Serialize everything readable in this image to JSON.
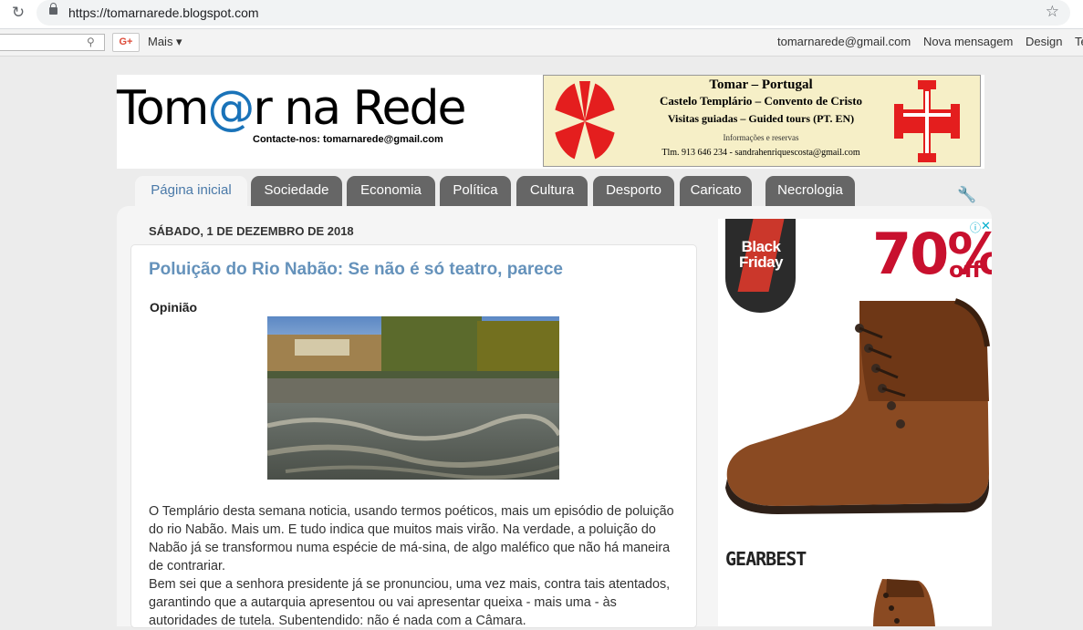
{
  "browser": {
    "url": "https://tomarnarede.blogspot.com"
  },
  "navbar": {
    "gplus_label": "G+",
    "more_label": "Mais ▾",
    "email": "tomarnarede@gmail.com",
    "new_post": "Nova mensagem",
    "design": "Design",
    "cut_off": "Te"
  },
  "header": {
    "title_part1": "Tom",
    "title_at": "@",
    "title_part2": "r na Rede",
    "contact": "Contacte-nos: tomarnarede@gmail.com",
    "banner": {
      "line1": "Tomar – Portugal",
      "line2": "Castelo Templário – Convento de Cristo",
      "line3": "Visitas guiadas – Guided tours (PT. EN)",
      "line4": "Informações e reservas",
      "line5": "Tlm. 913 646 234 - sandrahenriquescosta@gmail.com"
    }
  },
  "tabs": [
    {
      "label": "Página inicial",
      "active": true
    },
    {
      "label": "Sociedade"
    },
    {
      "label": "Economia"
    },
    {
      "label": "Política"
    },
    {
      "label": "Cultura"
    },
    {
      "label": "Desporto"
    },
    {
      "label": "Caricato"
    },
    {
      "label": "Necrologia"
    }
  ],
  "post": {
    "date": "SÁBADO, 1 DE DEZEMBRO DE 2018",
    "title": "Poluição do Rio Nabão: Se não é só teatro, parece",
    "label": "Opinião",
    "body": [
      "O Templário desta semana noticia, usando termos poéticos, mais um episódio de poluição do rio Nabão. Mais um. E tudo indica que muitos mais virão. Na verdade, a poluição do Nabão já se transformou numa espécie de má-sina, de algo maléfico que não há maneira de contrariar.",
      "Bem sei que a senhora presidente já se pronunciou, uma vez mais, contra tais atentados, garantindo que a autarquia apresentou ou vai apresentar queixa - mais uma - às autoridades de tutela. Subentendido: não é nada com a Câmara."
    ]
  },
  "ad": {
    "badge_line1": "Black",
    "badge_line2": "Friday",
    "discount": "70%",
    "off": "off",
    "brand": "GEARBEST"
  }
}
